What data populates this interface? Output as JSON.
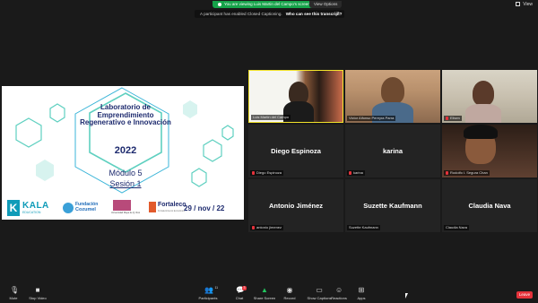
{
  "top": {
    "sharing_notice": "You are viewing Luis Martin del Campo's screen",
    "view_options": "View Options",
    "view_button": "View"
  },
  "caption_banner": {
    "message": "A participant has enabled Closed Captioning.",
    "link": "Who can see this transcript?"
  },
  "slide": {
    "title_line1": "Laboratorio de",
    "title_line2": "Emprendimiento",
    "title_line3": "Regenerativo e Innovación",
    "year": "2022",
    "module": "Módulo 5",
    "session": "Sesión 1",
    "date": "29 / nov / 22",
    "logo_kala_letter": "K",
    "logo_kala_name": "KALA",
    "logo_kala_sub": "EDUCATION",
    "logo_fundacion_1": "Fundación",
    "logo_fundacion_2": "Cozumel",
    "logo_castle_text": "Universidad Maya de Q. Roo",
    "logo_fort_name": "Fortaleco",
    "logo_fort_sub": "Fortalecimiento Económico"
  },
  "participants": [
    {
      "name": "Luis Martin del Campo",
      "video": true,
      "muted": false
    },
    {
      "name": "Victor Alfonso Pereyra Parra",
      "video": true,
      "muted": false
    },
    {
      "name": "Elisen",
      "video": true,
      "muted": true
    },
    {
      "display": "Diego Espinoza",
      "name": "Diego Espinoza",
      "video": false,
      "muted": true
    },
    {
      "display": "karina",
      "name": "karina",
      "video": false,
      "muted": true
    },
    {
      "name": "Rodolfo I. Segura Chan",
      "video": true,
      "muted": true
    },
    {
      "display": "Antonio Jiménez",
      "name": "antonio jimenez",
      "video": false,
      "muted": true
    },
    {
      "display": "Suzette Kaufmann",
      "name": "Suzette Kaufmann",
      "video": false,
      "muted": false
    },
    {
      "display": "Claudia Nava",
      "name": "Claudia Nava",
      "video": false,
      "muted": false
    }
  ],
  "toolbar": {
    "mute": "Mute",
    "stop_video": "Stop Video",
    "participants": "Participants",
    "participants_count": "11",
    "chat": "Chat",
    "chat_badge": "3",
    "share_screen": "Share Screen",
    "record": "Record",
    "show_captions": "Show Captions",
    "reactions": "Reactions",
    "apps": "Apps",
    "leave": "Leave"
  },
  "colors": {
    "accent_green": "#16a34a",
    "active_speaker": "#f2e32a",
    "leave_red": "#e5323b",
    "slide_navy": "#1d2a6e"
  }
}
